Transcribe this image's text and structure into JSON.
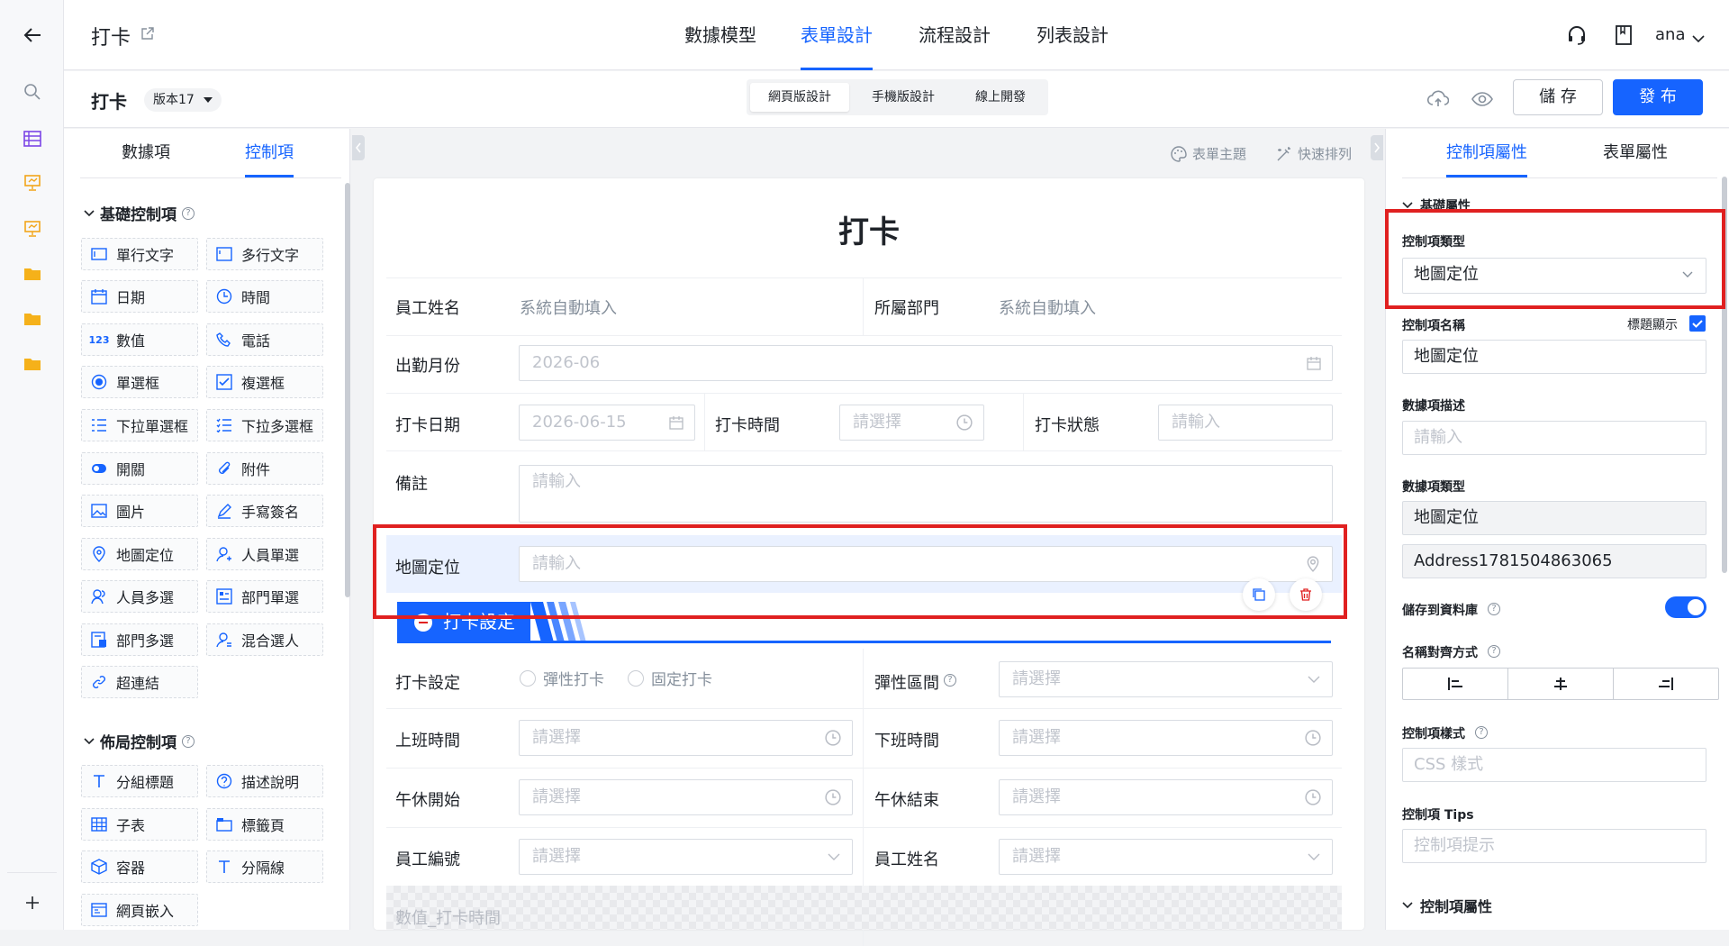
{
  "header": {
    "title": "打卡",
    "tabs": [
      "數據模型",
      "表單設計",
      "流程設計",
      "列表設計"
    ],
    "active_tab": "表單設計",
    "user": "ana"
  },
  "subbar": {
    "form_name": "打卡",
    "version": "版本17",
    "modes": [
      "網頁版設計",
      "手機版設計",
      "線上開發"
    ],
    "active_mode": "網頁版設計",
    "save_label": "儲 存",
    "publish_label": "發 布"
  },
  "left": {
    "tabs": [
      "數據項",
      "控制項"
    ],
    "active_tab": "控制項",
    "basic_title": "基礎控制項",
    "basic_items": [
      "單行文字",
      "多行文字",
      "日期",
      "時間",
      "數值",
      "電話",
      "單選框",
      "複選框",
      "下拉單選框",
      "下拉多選框",
      "開關",
      "附件",
      "圖片",
      "手寫簽名",
      "地圖定位",
      "人員單選",
      "人員多選",
      "部門單選",
      "部門多選",
      "混合選人",
      "超連結"
    ],
    "layout_title": "佈局控制項",
    "layout_items": [
      "分組標題",
      "描述說明",
      "子表",
      "標籤頁",
      "容器",
      "分隔線",
      "網頁嵌入"
    ]
  },
  "canvas": {
    "theme_label": "表單主題",
    "arrange_label": "快速排列",
    "form_title": "打卡",
    "employee_name_label": "員工姓名",
    "employee_name_value": "系統自動填入",
    "dept_label": "所屬部門",
    "dept_value": "系統自動填入",
    "month_label": "出勤月份",
    "month_value": "2026-06",
    "date_label": "打卡日期",
    "date_value": "2026-06-15",
    "time_label": "打卡時間",
    "time_placeholder": "請選擇",
    "status_label": "打卡狀態",
    "status_placeholder": "請輸入",
    "remark_label": "備註",
    "remark_placeholder": "請輸入",
    "map_label": "地圖定位",
    "map_placeholder": "請輸入",
    "banner_text": "打卡設定",
    "setting_label": "打卡設定",
    "radio_flexible": "彈性打卡",
    "radio_fixed": "固定打卡",
    "flex_range_label": "彈性區間",
    "select_placeholder": "請選擇",
    "on_time_label": "上班時間",
    "off_time_label": "下班時間",
    "lunch_start_label": "午休開始",
    "lunch_end_label": "午休結束",
    "emp_no_label": "員工編號",
    "emp_name_label2": "員工姓名",
    "numeric_label": "數值_打卡時間"
  },
  "right": {
    "tabs": [
      "控制項屬性",
      "表單屬性"
    ],
    "active_tab": "控制項屬性",
    "basic_section": "基礎屬性",
    "ctrl_type_label": "控制項類型",
    "ctrl_type_value": "地圖定位",
    "ctrl_name_label": "控制項名稱",
    "title_show_label": "標題顯示",
    "ctrl_name_value": "地圖定位",
    "desc_label": "數據項描述",
    "desc_placeholder": "請輸入",
    "data_type_label": "數據項類型",
    "data_type_value": "地圖定位",
    "data_code_value": "Address1781504863065",
    "save_db_label": "儲存到資料庫",
    "align_label": "名稱對齊方式",
    "style_label": "控制項樣式",
    "style_placeholder": "CSS 樣式",
    "tips_label": "控制項 Tips",
    "tips_placeholder": "控制項提示",
    "ctrl_attr_section": "控制項屬性"
  },
  "colors": {
    "accent": "#1664ff",
    "highlight": "#e02020",
    "selected_row": "#eaf1ff"
  }
}
